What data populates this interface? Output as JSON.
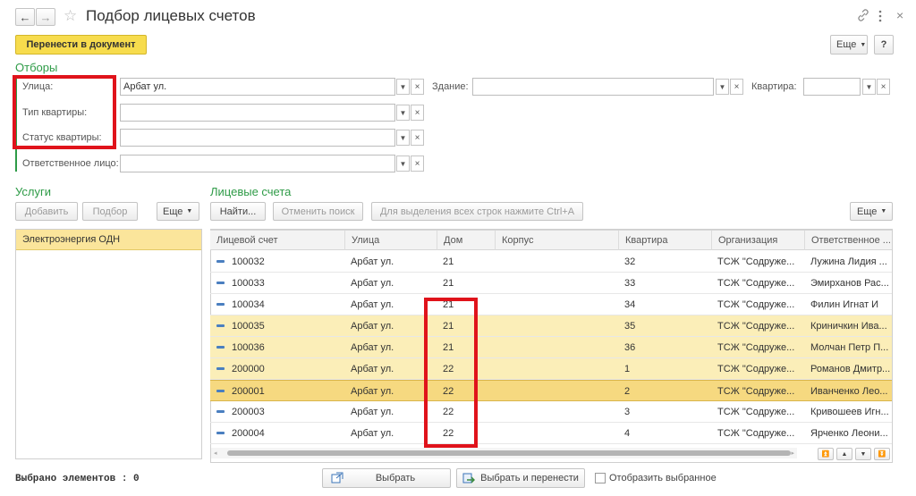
{
  "window": {
    "title": "Подбор лицевых счетов",
    "nav_back": "←",
    "nav_forward": "→",
    "star": "☆",
    "link_icon": "link-icon",
    "menu_icon": "more-vertical-icon",
    "close": "×"
  },
  "toolbar": {
    "transfer_label": "Перенести в документ",
    "more_label": "Еще",
    "help_label": "?"
  },
  "filters": {
    "section_title": "Отборы",
    "street_label": "Улица:",
    "street_value": "Арбат ул.",
    "building_label": "Здание:",
    "building_value": "",
    "apartment_label": "Квартира:",
    "apartment_value": "",
    "apt_type_label": "Тип квартиры:",
    "apt_type_value": "",
    "apt_status_label": "Статус квартиры:",
    "apt_status_value": "",
    "responsible_label": "Ответственное лицо:",
    "responsible_value": ""
  },
  "services": {
    "title": "Услуги",
    "add_label": "Добавить",
    "pick_label": "Подбор",
    "more_label": "Еще",
    "items": [
      "Электроэнергия ОДН"
    ]
  },
  "accounts": {
    "title": "Лицевые счета",
    "find_label": "Найти...",
    "cancel_search_label": "Отменить поиск",
    "select_all_hint": "Для выделения всех строк нажмите Ctrl+A",
    "more_label": "Еще",
    "columns": [
      "Лицевой счет",
      "Улица",
      "Дом",
      "Корпус",
      "Квартира",
      "Организация",
      "Ответственное ..."
    ],
    "rows": [
      {
        "account": "100032",
        "street": "Арбат ул.",
        "house": "21",
        "corpus": "",
        "apartment": "32",
        "org": "ТСЖ \"Содруже...",
        "person": "Лужина Лидия ...",
        "state": "normal"
      },
      {
        "account": "100033",
        "street": "Арбат ул.",
        "house": "21",
        "corpus": "",
        "apartment": "33",
        "org": "ТСЖ \"Содруже...",
        "person": "Эмирханов Рас...",
        "state": "normal"
      },
      {
        "account": "100034",
        "street": "Арбат ул.",
        "house": "21",
        "corpus": "",
        "apartment": "34",
        "org": "ТСЖ \"Содруже...",
        "person": "Филин Игнат И",
        "state": "normal"
      },
      {
        "account": "100035",
        "street": "Арбат ул.",
        "house": "21",
        "corpus": "",
        "apartment": "35",
        "org": "ТСЖ \"Содруже...",
        "person": "Криничкин Ива...",
        "state": "selected"
      },
      {
        "account": "100036",
        "street": "Арбат ул.",
        "house": "21",
        "corpus": "",
        "apartment": "36",
        "org": "ТСЖ \"Содруже...",
        "person": "Молчан Петр П...",
        "state": "selected"
      },
      {
        "account": "200000",
        "street": "Арбат ул.",
        "house": "22",
        "corpus": "",
        "apartment": "1",
        "org": "ТСЖ \"Содруже...",
        "person": "Романов Дмитр...",
        "state": "selected"
      },
      {
        "account": "200001",
        "street": "Арбат ул.",
        "house": "22",
        "corpus": "",
        "apartment": "2",
        "org": "ТСЖ \"Содруже...",
        "person": "Иванченко Лео...",
        "state": "current"
      },
      {
        "account": "200003",
        "street": "Арбат ул.",
        "house": "22",
        "corpus": "",
        "apartment": "3",
        "org": "ТСЖ \"Содруже...",
        "person": "Кривошеев Игн...",
        "state": "normal"
      },
      {
        "account": "200004",
        "street": "Арбат ул.",
        "house": "22",
        "corpus": "",
        "apartment": "4",
        "org": "ТСЖ \"Содруже...",
        "person": "Ярченко Леони...",
        "state": "normal"
      }
    ]
  },
  "footer": {
    "selected_count_label": "Выбрано элементов : 0",
    "select_label": "Выбрать",
    "select_transfer_label": "Выбрать и перенести",
    "show_selected_label": "Отобразить выбранное",
    "show_selected_checked": false
  },
  "colors": {
    "accent_green": "#2e9b47",
    "highlight_red": "#e0131b",
    "primary_button": "#f7dc4d",
    "row_selected": "#fbeeb8",
    "row_current": "#f6d980"
  }
}
